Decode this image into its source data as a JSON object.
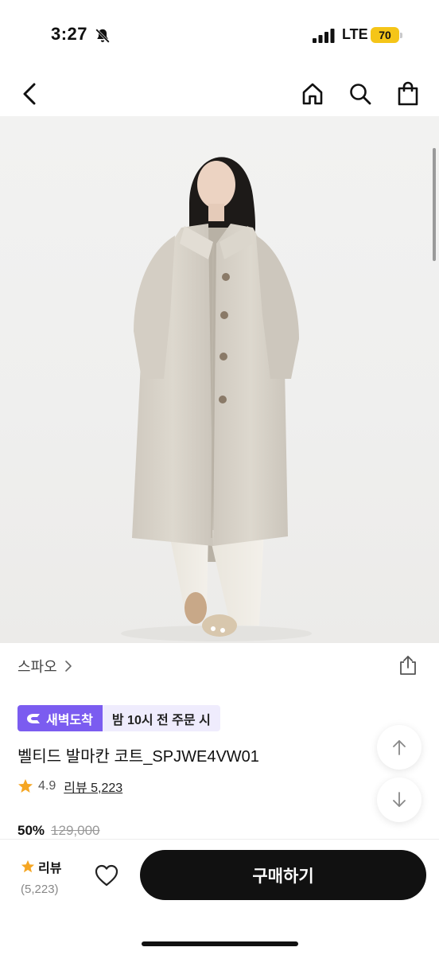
{
  "status_bar": {
    "time": "3:27",
    "network": "LTE",
    "battery": "70",
    "icons": [
      "bell-slash-icon",
      "signal-icon",
      "battery-icon"
    ]
  },
  "nav": {
    "icons": [
      "back-chevron-icon",
      "home-icon",
      "search-icon",
      "shopping-bag-icon"
    ]
  },
  "hero": {
    "image_icon": "product-photo",
    "carousel_position": 0.05
  },
  "product": {
    "brand": "스파오",
    "delivery_badge": "새벽도착",
    "delivery_note": "밤 10시 전 주문 시",
    "title": "벨티드 발마칸 코트_SPJWE4VW01",
    "rating": "4.9",
    "review_link": "리뷰 5,223",
    "discount": "50%",
    "original_price": "129,000"
  },
  "bottom_bar": {
    "review_label": "리뷰",
    "review_count": "(5,223)",
    "buy_label": "구매하기"
  },
  "colors": {
    "accent_purple": "#7b5cf0",
    "badge_bg": "#efecfd",
    "star": "#f5a623",
    "buy_button": "#111111",
    "battery": "#f5c518"
  }
}
